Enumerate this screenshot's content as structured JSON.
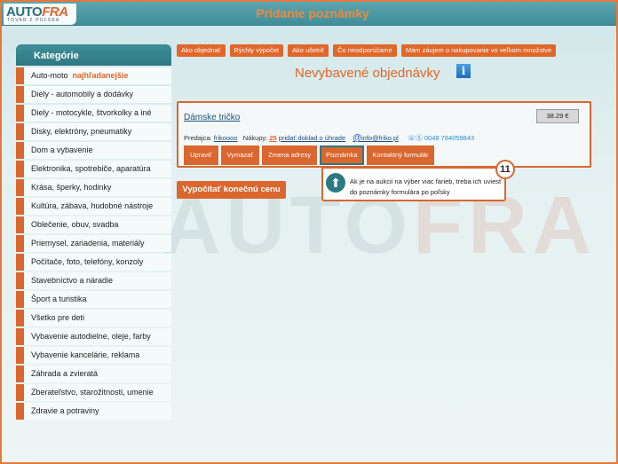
{
  "header": {
    "logo_auto": "AUTO",
    "logo_fra": "FRA",
    "logo_sub": "TOVAR Z POĽSKA",
    "title": "Pridanie poznámky"
  },
  "watermark": {
    "auto": "AUTO",
    "fra": "FRA"
  },
  "sidebar": {
    "title": "Kategórie",
    "hot_label": "najhľadanejšie",
    "items": [
      "Auto-moto",
      "Diely - automobily a dodávky",
      "Diely - motocykle, štvorkolky a iné",
      "Disky, elektróny, pneumatiky",
      "Dom a vybavenie",
      "Elektronika, spotrebiče, aparatúra",
      "Krása, šperky, hodinky",
      "Kultúra, zábava, hudobné nástroje",
      "Oblečenie, obuv, svadba",
      "Priemysel, zariadenia, materiály",
      "Počítače, foto, telefóny, konzoly",
      "Stavebníctvo a náradie",
      "Šport a turistika",
      "Všetko pre deti",
      "Vybavenie autodielne, oleje, farby",
      "Vybavenie kancelárie, reklama",
      "Záhrada a zvieratá",
      "Zberateľstvo, starožitnosti, umenie",
      "Zdravie a potraviny"
    ]
  },
  "toplinks": [
    "Ako objednať",
    "Rýchly výpočet",
    "Ako ušetriť",
    "Čo neodporúčame",
    "Mám záujem o nakupovanie vo veľkom množstve"
  ],
  "main": {
    "heading": "Nevybavené objednávky",
    "info_icon": "i",
    "product_name": "Dámske tričko",
    "price": "38.29 €",
    "seller_label": "Predajca:",
    "seller_name": "frikoooo",
    "purchases_label": "Nákupy:",
    "purchases_count": "25",
    "payment_link": "pridať doklad o úhrade",
    "email": "info@friko.pl",
    "phone": "0048 784059843",
    "actions": [
      "Upraviť",
      "Vymazať",
      "Zmena adresy",
      "Poznámka",
      "Kontaktný formulár"
    ],
    "active_action": "Poznámka",
    "calc_button": "Vypočítať konečnú cenu"
  },
  "tooltip": {
    "text": "Ak je na aukcii na výber viac farieb, treba ich uviesť do poznámky formulára po poľsky",
    "badge": "11"
  },
  "colors": {
    "accent": "#d9672f",
    "teal": "#2f7783"
  }
}
